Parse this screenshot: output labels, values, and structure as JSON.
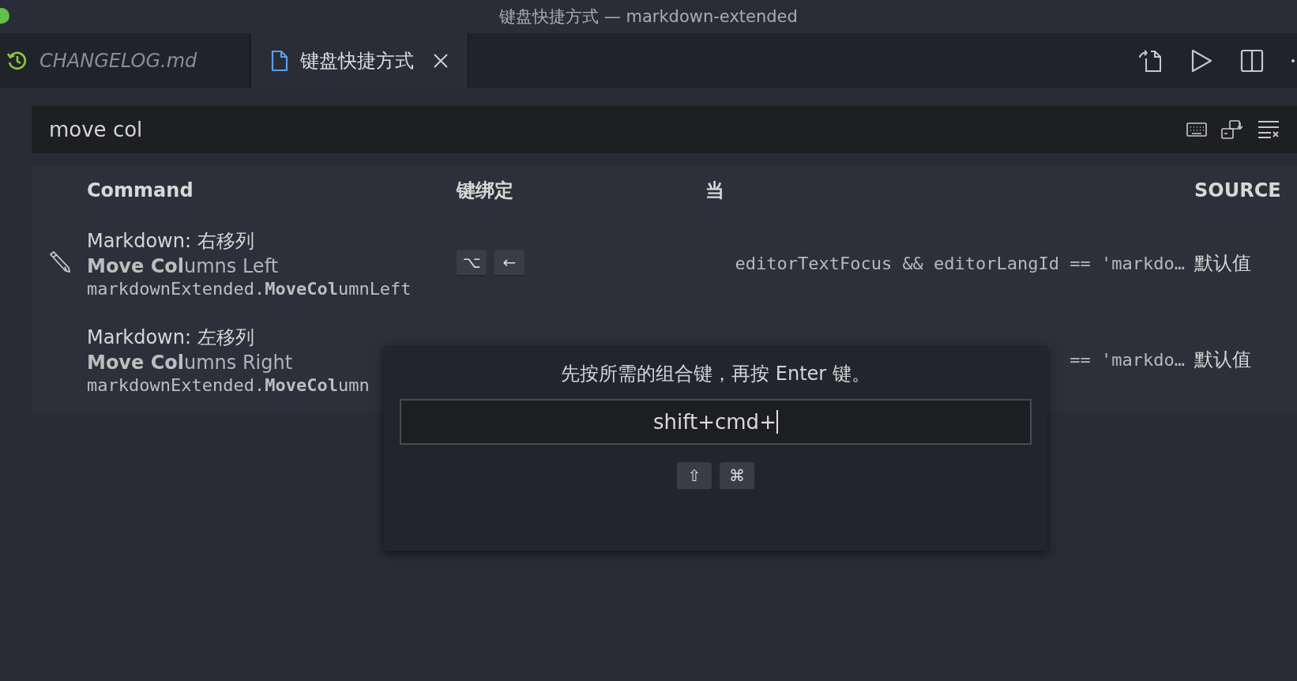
{
  "window": {
    "title": "键盘快捷方式 — markdown-extended"
  },
  "tabs": [
    {
      "label": "CHANGELOG.md",
      "kind": "history",
      "selected": false,
      "preview": true,
      "closable": false
    },
    {
      "label": "键盘快捷方式",
      "kind": "file",
      "selected": true,
      "preview": false,
      "closable": true
    }
  ],
  "search": {
    "value": "move col"
  },
  "table": {
    "columns": [
      "Command",
      "键绑定",
      "当",
      "SOURCE"
    ],
    "rows": [
      {
        "title": "Markdown: 右移列",
        "label": "**Move Col**umns Left",
        "command_id": "markdownExtended.**MoveCol**umnLeft",
        "keys": [
          "⌥",
          "←"
        ],
        "when": "editorTextFocus && editorLangId == 'markdo…",
        "source": "默认值",
        "hovered": true
      },
      {
        "title": "Markdown: 左移列",
        "label": "**Move Col**umns Right",
        "command_id": "markdownExtended.**MoveCol**umn",
        "when": "== 'markdo…",
        "source": "默认值",
        "hovered": false
      }
    ]
  },
  "dialog": {
    "message": "先按所需的组合键，再按 Enter 键。",
    "value": "shift+cmd+",
    "keys": [
      "⇧",
      "⌘"
    ]
  }
}
